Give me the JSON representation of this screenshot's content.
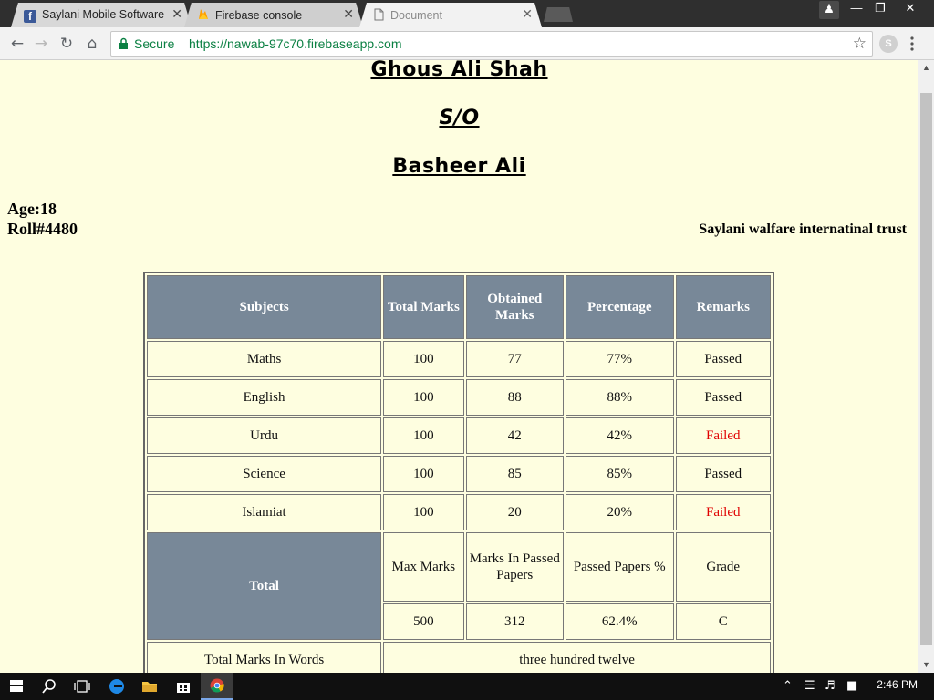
{
  "browser": {
    "tabs": [
      {
        "title": "Saylani Mobile Software",
        "icon": "facebook-icon",
        "close": "✕"
      },
      {
        "title": "Firebase console",
        "icon": "firebase-icon",
        "close": "✕"
      },
      {
        "title": "Document",
        "icon": "document-icon",
        "close": "✕"
      }
    ],
    "omnibox": {
      "secure_label": "Secure",
      "url": "https://nawab-97c70.firebaseapp.com"
    },
    "profile_initial": "S"
  },
  "page": {
    "student_name": "Ghous Ali Shah",
    "relation": "S/O",
    "father_name": "Basheer Ali",
    "age": "Age:18",
    "roll": "Roll#4480",
    "organization": "Saylani walfare internatinal trust"
  },
  "table": {
    "headers": {
      "subjects": "Subjects",
      "total_marks": "Total Marks",
      "obtained_marks": "Obtained Marks",
      "percentage": "Percentage",
      "remarks": "Remarks"
    },
    "rows": [
      {
        "subject": "Maths",
        "total": "100",
        "obtained": "77",
        "percentage": "77%",
        "remark": "Passed"
      },
      {
        "subject": "English",
        "total": "100",
        "obtained": "88",
        "percentage": "88%",
        "remark": "Passed"
      },
      {
        "subject": "Urdu",
        "total": "100",
        "obtained": "42",
        "percentage": "42%",
        "remark": "Failed"
      },
      {
        "subject": "Science",
        "total": "100",
        "obtained": "85",
        "percentage": "85%",
        "remark": "Passed"
      },
      {
        "subject": "Islamiat",
        "total": "100",
        "obtained": "20",
        "percentage": "20%",
        "remark": "Failed"
      }
    ],
    "total": {
      "label": "Total",
      "max_marks_label": "Max Marks",
      "passed_marks_label": "Marks In Passed Papers",
      "passed_percent_label": "Passed Papers %",
      "grade_label": "Grade",
      "max_marks": "500",
      "passed_marks": "312",
      "passed_percent": "62.4%",
      "grade": "C"
    },
    "words": {
      "label": "Total Marks In Words",
      "value": "three hundred twelve"
    }
  },
  "taskbar": {
    "time": "2:46 PM"
  },
  "colors": {
    "page_background": "#fefee0",
    "header_background": "#788898",
    "failed": "#e00000",
    "secure": "#0b8043"
  }
}
